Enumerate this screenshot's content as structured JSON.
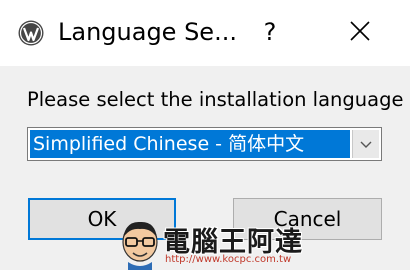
{
  "window": {
    "title": "Language Se...",
    "help_label": "?",
    "app_icon": "wordpress-icon",
    "close_icon": "close-icon"
  },
  "dialog": {
    "prompt": "Please select the installation language",
    "language_select": {
      "selected": "Simplified Chinese - 简体中文",
      "arrow_icon": "chevron-down-icon"
    },
    "ok_label": "OK",
    "cancel_label": "Cancel"
  },
  "watermark": {
    "text": "電腦王阿達",
    "url": "http://www.kocpc.com.tw"
  },
  "colors": {
    "accent": "#0078d7",
    "dialog_bg": "#f0f0f0",
    "button_bg": "#e1e1e1",
    "watermark_url": "#c0392b"
  }
}
